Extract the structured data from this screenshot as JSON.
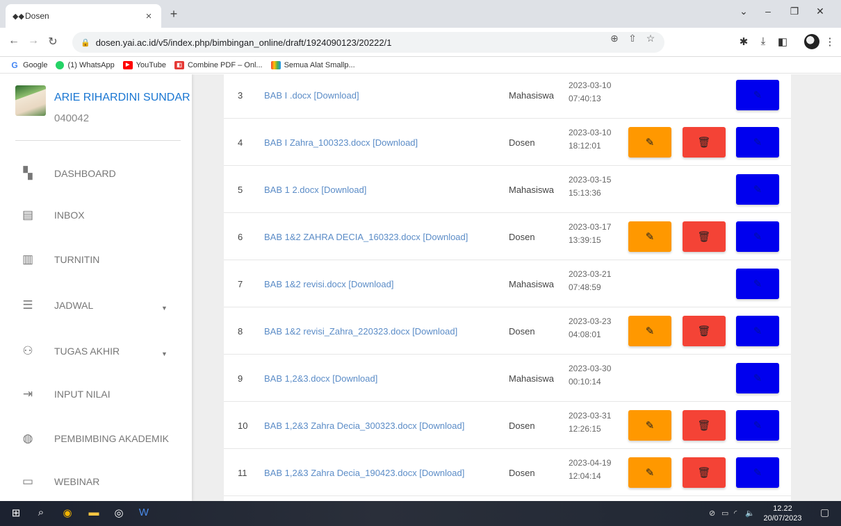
{
  "browser": {
    "tab_title": "Dosen",
    "url": "dosen.yai.ac.id/v5/index.php/bimbingan_online/draft/1924090123/20222/1",
    "bookmarks": [
      {
        "label": "Google",
        "icon": "google-icon",
        "color": "#4285f4"
      },
      {
        "label": "(1) WhatsApp",
        "icon": "whatsapp-icon",
        "color": "#25d366"
      },
      {
        "label": "YouTube",
        "icon": "youtube-icon",
        "color": "#ff0000"
      },
      {
        "label": "Combine PDF – Onl...",
        "icon": "pdf-icon",
        "color": "#e53935"
      },
      {
        "label": "Semua Alat Smallp...",
        "icon": "smallpdf-icon",
        "color": "#7b61ff"
      }
    ]
  },
  "sidebar": {
    "name": "ARIE RIHARDINI SUNDAR",
    "id": "040042",
    "items": [
      {
        "label": "DASHBOARD",
        "icon": "dashboard-icon",
        "glyph": "▚"
      },
      {
        "label": "INBOX",
        "icon": "inbox-icon",
        "glyph": "▤"
      },
      {
        "label": "TURNITIN",
        "icon": "turnitin-icon",
        "glyph": "▥"
      },
      {
        "label": "JADWAL",
        "icon": "jadwal-icon",
        "glyph": "☰"
      },
      {
        "label": "TUGAS AKHIR",
        "icon": "tugas-akhir-icon",
        "glyph": "⚇"
      },
      {
        "label": "INPUT NILAI",
        "icon": "input-nilai-icon",
        "glyph": "⇥"
      },
      {
        "label": "PEMBIMBING AKADEMIK",
        "icon": "pembimbing-akademik-icon",
        "glyph": "◍"
      },
      {
        "label": "WEBINAR",
        "icon": "webinar-icon",
        "glyph": "▭"
      }
    ]
  },
  "drafts": [
    {
      "no": "3",
      "file": "BAB I .docx [Download]",
      "by": "Mahasiswa",
      "date": "2023-03-10",
      "time": "07:40:13"
    },
    {
      "no": "4",
      "file": "BAB I Zahra_100323.docx [Download]",
      "by": "Dosen",
      "date": "2023-03-10",
      "time": "18:12:01"
    },
    {
      "no": "5",
      "file": "BAB 1 2.docx [Download]",
      "by": "Mahasiswa",
      "date": "2023-03-15",
      "time": "15:13:36"
    },
    {
      "no": "6",
      "file": "BAB 1&2 ZAHRA DECIA_160323.docx [Download]",
      "by": "Dosen",
      "date": "2023-03-17",
      "time": "13:39:15"
    },
    {
      "no": "7",
      "file": "BAB 1&2 revisi.docx [Download]",
      "by": "Mahasiswa",
      "date": "2023-03-21",
      "time": "07:48:59"
    },
    {
      "no": "8",
      "file": "BAB 1&2 revisi_Zahra_220323.docx [Download]",
      "by": "Dosen",
      "date": "2023-03-23",
      "time": "04:08:01"
    },
    {
      "no": "9",
      "file": "BAB 1,2&3.docx [Download]",
      "by": "Mahasiswa",
      "date": "2023-03-30",
      "time": "00:10:14"
    },
    {
      "no": "10",
      "file": "BAB 1,2&3 Zahra Decia_300323.docx [Download]",
      "by": "Dosen",
      "date": "2023-03-31",
      "time": "12:26:15"
    },
    {
      "no": "11",
      "file": "BAB 1,2&3 Zahra Decia_190423.docx [Download]",
      "by": "Dosen",
      "date": "2023-04-19",
      "time": "12:04:14"
    }
  ],
  "taskbar": {
    "time": "12.22",
    "date": "20/07/2023"
  },
  "colors": {
    "edit": "#ff9800",
    "delete": "#f44336",
    "view": "#0000ee",
    "link": "#5b8cc7",
    "profile_name": "#1976d2"
  }
}
